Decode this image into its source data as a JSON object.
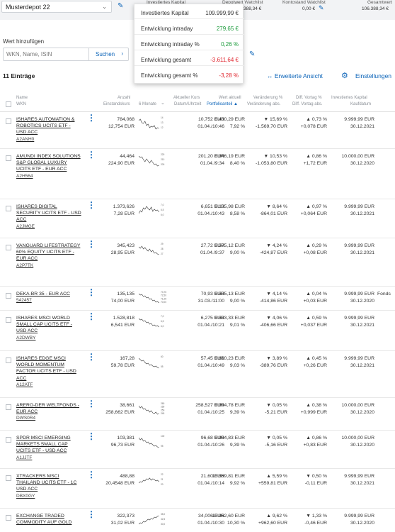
{
  "topbar": {
    "portfolio": "Musterdepot 22",
    "labels": [
      "Investiertes Kapital",
      "Depotwert Watchlist",
      "Kontostand Watchlist",
      "Gesamtwert"
    ],
    "values": [
      "388,34 €",
      "0,00 €",
      "106.388,34 €"
    ]
  },
  "popup": {
    "rows": [
      {
        "label": "Investiertes Kapital",
        "value": "109.999,99 €"
      },
      {
        "label": "Entwicklung intraday",
        "value": "279,65 €"
      },
      {
        "label": "Entwicklung intraday %",
        "value": "0,26 %"
      },
      {
        "label": "Entwicklung gesamt",
        "value": "-3.611,64 €"
      },
      {
        "label": "Entwicklung gesamt %",
        "value": "-3,28 %"
      }
    ]
  },
  "add": {
    "label": "Wert hinzufügen",
    "placeholder": "WKN, Name, ISIN",
    "button": "Suchen"
  },
  "list": {
    "count": "11 Einträge",
    "advanced": "Erweiterte Ansicht",
    "settings": "Einstellungen"
  },
  "header": {
    "name": "Name",
    "wkn": "WKN",
    "anzahl": "Anzahl",
    "einstandskurs": "Einstandskurs",
    "monate": "6 Monate",
    "kurs": "Aktueller Kurs",
    "datum": "Datum/Uhrzeit",
    "wert": "Wert aktuell",
    "portfolioanteil": "Portfolioanteil ▲",
    "veraenderung": "Veränderung %",
    "veraenderung_abs": "Veränderung abs.",
    "diff": "Diff. Vortag %",
    "diff_abs": "Diff. Vortag abs.",
    "kapital": "Investiertes Kapital",
    "kaufdatum": "Kaufdatum"
  },
  "rows": [
    {
      "name": "ISHARES AUTOMATION & ROBOTICS UCITS ETF - USD ACC",
      "wkn": "A2ANH0",
      "anzahl": "784,068",
      "einstand": "12,754 EUR",
      "kurs": "10,752 EUR",
      "datum": "01.04./10:46",
      "wert": "8.430,29 EUR",
      "anteil": "7,92 %",
      "ver": "▼ 15,69 %",
      "ver_abs": "-1.569,70 EUR",
      "diff": "▲ 0,73 %",
      "diff_abs": "+0,078 EUR",
      "kapital": "9.999,99 EUR",
      "kaufdatum": "30.12.2021",
      "extra": "",
      "spark_labels": [
        "14",
        "13",
        "12"
      ]
    },
    {
      "name": "AMUNDI INDEX SOLUTIONS S&P GLOBAL LUXURY UCITS ETF - EUR ACC",
      "wkn": "A2H564",
      "anzahl": "44,464",
      "einstand": "224,90 EUR",
      "kurs": "201,20 EUR",
      "datum": "01.04./9:34",
      "wert": "8.946,19 EUR",
      "anteil": "8,40 %",
      "ver": "▼ 10,53 %",
      "ver_abs": "-1.053,80 EUR",
      "diff": "▲ 0,86 %",
      "diff_abs": "+1,72 EUR",
      "kapital": "10.000,00 EUR",
      "kaufdatum": "30.12.2020",
      "extra": "",
      "spark_labels": [
        "220",
        "210",
        "200"
      ]
    },
    {
      "name": "ISHARES DIGITAL SECURITY UCITS ETF - USD ACC",
      "wkn": "A2JMGE",
      "anzahl": "1.373,626",
      "einstand": "7,28 EUR",
      "kurs": "6,651 EUR",
      "datum": "01.04./10:43",
      "wert": "9.135,98 EUR",
      "anteil": "8,58 %",
      "ver": "▼ 8,64 %",
      "ver_abs": "-864,01 EUR",
      "diff": "▲ 0,97 %",
      "diff_abs": "+0,064 EUR",
      "kapital": "9.999,99 EUR",
      "kaufdatum": "30.12.2021",
      "extra": "",
      "spark_labels": [
        "7,0",
        "6,5",
        "6,0"
      ]
    },
    {
      "name": "VANGUARD LIFESTRATEGY 60% EQUITY UCITS ETF - EUR ACC",
      "wkn": "A2P7TK",
      "anzahl": "345,423",
      "einstand": "28,95 EUR",
      "kurs": "27,72 EUR",
      "datum": "01.04./9:37",
      "wert": "9.575,12 EUR",
      "anteil": "9,00 %",
      "ver": "▼ 4,24 %",
      "ver_abs": "-424,87 EUR",
      "diff": "▲ 0,29 %",
      "diff_abs": "+0,08 EUR",
      "kapital": "9.999,99 EUR",
      "kaufdatum": "30.12.2021",
      "extra": "",
      "spark_labels": [
        "29",
        "28",
        "27"
      ]
    },
    {
      "name": "DEKA-BR 35 - EUR ACC",
      "wkn": "542457",
      "anzahl": "135,135",
      "einstand": "74,00 EUR",
      "kurs": "70,93 EUR",
      "datum": "31.03./11:00",
      "wert": "9.585,13 EUR",
      "anteil": "9,00 %",
      "ver": "▼ 4,14 %",
      "ver_abs": "-414,86 EUR",
      "diff": "▲ 0,04 %",
      "diff_abs": "+0,03 EUR",
      "kapital": "9.999,99 EUR",
      "kaufdatum": "30.12.2020",
      "extra": "Fonds",
      "spark_labels": [
        "73,75",
        "72,50",
        "71,25",
        "70,00"
      ]
    },
    {
      "name": "ISHARES MSCI WORLD SMALL CAP UCITS ETF - USD ACC",
      "wkn": "A2DWBY",
      "anzahl": "1.528,818",
      "einstand": "6,541 EUR",
      "kurs": "6,275 EUR",
      "datum": "01.04./10:21",
      "wert": "9.593,33 EUR",
      "anteil": "9,01 %",
      "ver": "▼ 4,06 %",
      "ver_abs": "-406,66 EUR",
      "diff": "▲ 0,59 %",
      "diff_abs": "+0,037 EUR",
      "kapital": "9.999,99 EUR",
      "kaufdatum": "30.12.2021",
      "extra": "",
      "spark_labels": [
        "7,0",
        "6,5",
        "6,0"
      ]
    },
    {
      "name": "ISHARES EDGE MSCI WORLD MOMENTUM FACTOR UCITS ETF - USD ACC",
      "wkn": "A12ATF",
      "anzahl": "167,28",
      "einstand": "59,78 EUR",
      "kurs": "57,45 EUR",
      "datum": "01.04./10:49",
      "wert": "9.610,23 EUR",
      "anteil": "9,03 %",
      "ver": "▼ 3,89 %",
      "ver_abs": "-389,76 EUR",
      "diff": "▲ 0,45 %",
      "diff_abs": "+0,26 EUR",
      "kapital": "9.999,99 EUR",
      "kaufdatum": "30.12.2021",
      "extra": "",
      "spark_labels": [
        "60",
        "55"
      ]
    },
    {
      "name": "ARERO-DER WELTFONDS - EUR ACC",
      "wkn": "DWS0R4",
      "anzahl": "38,661",
      "einstand": "258,662 EUR",
      "kurs": "258,527 EUR",
      "datum": "01.04./10:25",
      "wert": "9.994,78 EUR",
      "anteil": "9,39 %",
      "ver": "▼ 0,05 %",
      "ver_abs": "-5,21 EUR",
      "diff": "▲ 0,38 %",
      "diff_abs": "+0,999 EUR",
      "kapital": "10.000,00 EUR",
      "kaufdatum": "30.12.2020",
      "extra": "",
      "spark_labels": [
        "260",
        "255",
        "250",
        "245"
      ]
    },
    {
      "name": "SPDR MSCI EMERGING MARKETS SMALL CAP UCITS ETF - USD ACC",
      "wkn": "A1JJTF",
      "anzahl": "103,381",
      "einstand": "96,73 EUR",
      "kurs": "96,68 EUR",
      "datum": "01.04./10:26",
      "wert": "9.994,83 EUR",
      "anteil": "9,39 %",
      "ver": "▼ 0,05 %",
      "ver_abs": "-5,16 EUR",
      "diff": "▲ 0,86 %",
      "diff_abs": "+0,83 EUR",
      "kapital": "10.000,00 EUR",
      "kaufdatum": "30.12.2020",
      "extra": "",
      "spark_labels": [
        "100",
        "95"
      ]
    },
    {
      "name": "XTRACKERS MSCI THAILAND UCITS ETF - 1C USD ACC",
      "wkn": "DBX0GY",
      "anzahl": "488,88",
      "einstand": "20,4548 EUR",
      "kurs": "21,60 EUR",
      "datum": "01.04./10:14",
      "wert": "10.559,81 EUR",
      "anteil": "9,92 %",
      "ver": "▲ 5,59 %",
      "ver_abs": "+559,81 EUR",
      "diff": "▼ 0,50 %",
      "diff_abs": "-0,11 EUR",
      "kapital": "9.999,99 EUR",
      "kaufdatum": "30.12.2021",
      "extra": "",
      "spark_labels": [
        "22",
        "21",
        "20"
      ]
    },
    {
      "name": "EXCHANGE TRADED COMMODITY AUF GOLD",
      "wkn": "",
      "anzahl": "322,373",
      "einstand": "31,02 EUR",
      "kurs": "34,006 EUR",
      "datum": "01.04./10:30",
      "wert": "10.962,60 EUR",
      "anteil": "10,30 %",
      "ver": "▲ 9,62 %",
      "ver_abs": "+962,60 EUR",
      "diff": "▼ 1,33 %",
      "diff_abs": "-0,46 EUR",
      "kapital": "9.999,99 EUR",
      "kaufdatum": "30.12.2020",
      "extra": "",
      "spark_labels": [
        "35,0",
        "32,5",
        "30,0"
      ]
    }
  ],
  "colors": {
    "accent": "#0a63b8",
    "positive": "#1a9a3a",
    "negative": "#e0262f"
  }
}
